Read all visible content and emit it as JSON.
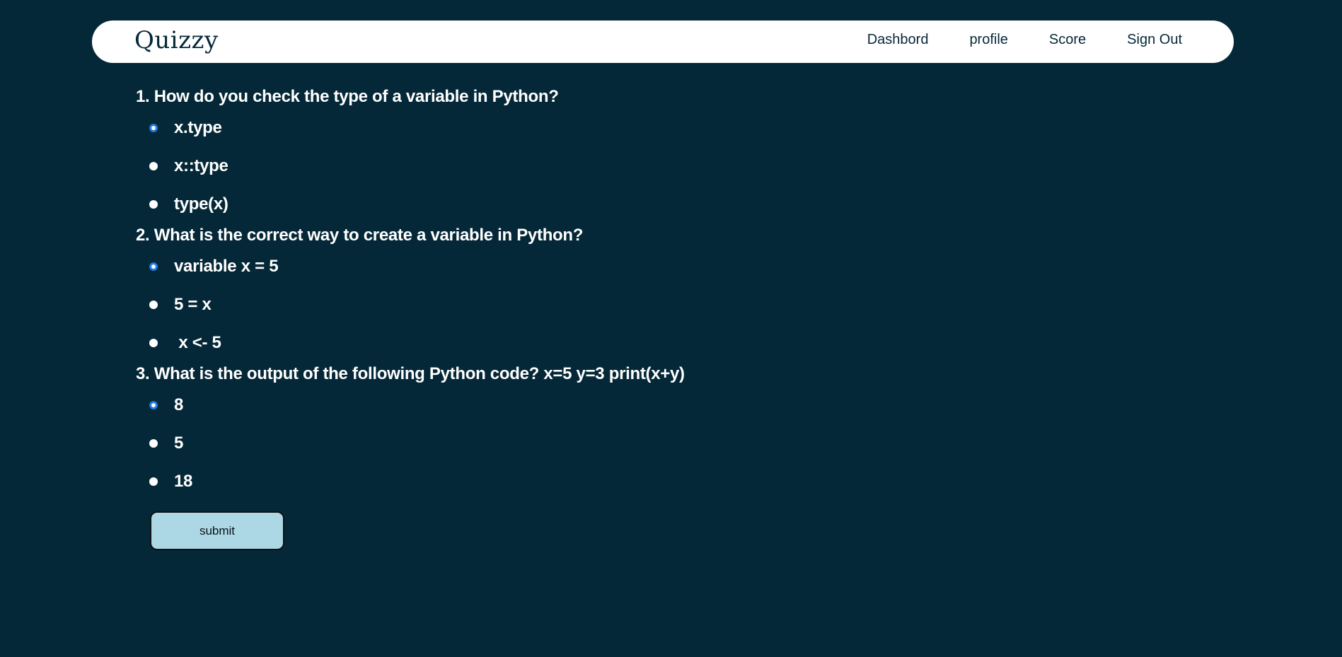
{
  "app": {
    "brand": "Quizzy"
  },
  "nav": {
    "items": [
      {
        "label": "Dashbord"
      },
      {
        "label": "profile"
      },
      {
        "label": "Score"
      },
      {
        "label": "Sign Out"
      }
    ]
  },
  "quiz": {
    "questions": [
      {
        "text": "1. How do you check the type of a variable in Python?",
        "options": [
          {
            "label": "x.type",
            "checked": true
          },
          {
            "label": "x::type",
            "checked": false
          },
          {
            "label": "type(x)",
            "checked": false
          }
        ]
      },
      {
        "text": "2. What is the correct way to create a variable in Python?",
        "options": [
          {
            "label": "variable x = 5",
            "checked": true
          },
          {
            "label": "5 = x",
            "checked": false
          },
          {
            "label": " x <- 5",
            "checked": false
          }
        ]
      },
      {
        "text": "3. What is the output of the following Python code? x=5 y=3 print(x+y)",
        "options": [
          {
            "label": "8",
            "checked": true
          },
          {
            "label": "5",
            "checked": false
          },
          {
            "label": "18",
            "checked": false
          }
        ]
      }
    ],
    "submit_label": "submit"
  },
  "colors": {
    "background": "#052838",
    "navbar": "#ffffff",
    "radio_checked": "#1f7ce6",
    "submit_button": "#acd8e6"
  }
}
